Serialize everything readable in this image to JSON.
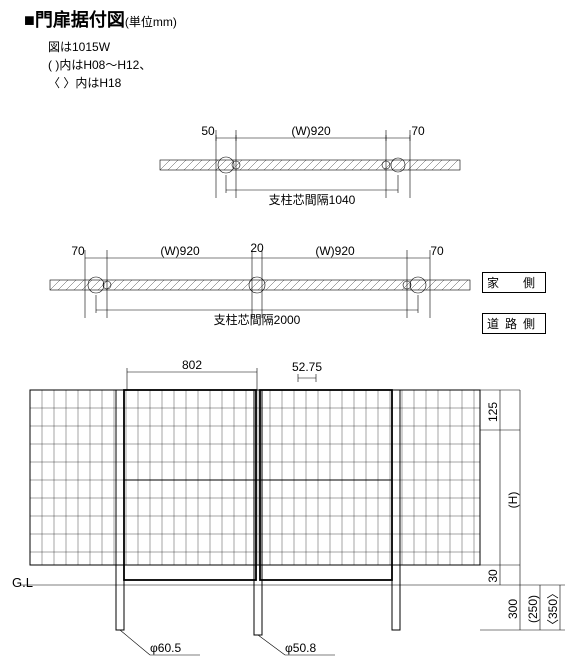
{
  "title": "■門扉据付図",
  "unit": "(単位mm)",
  "subtitle_line1": "図は1015W",
  "subtitle_line2": "(   )内はH08〜H12、",
  "subtitle_line3": "〈  〉内はH18",
  "plan_single": {
    "left_gap": "50",
    "width_label": "(W)920",
    "right_gap": "70",
    "post_span_label": "支柱芯間隔1040"
  },
  "plan_double": {
    "left_gap": "70",
    "width_left": "(W)920",
    "center_gap": "20",
    "width_right": "(W)920",
    "right_gap": "70",
    "post_span_label": "支柱芯間隔2000",
    "side_house": "家　側",
    "side_road": "道路側"
  },
  "elevation": {
    "leaf_width": "802",
    "latch_offset": "52.75",
    "dim_top": "125",
    "dim_h": "(H)",
    "dim_bottom_gap": "30",
    "embed_outer": "300",
    "embed_paren": "(250)",
    "embed_angle": "〈350〉",
    "gl": "G.L",
    "post_dia_outer": "φ60.5",
    "post_dia_inner": "φ50.8"
  }
}
